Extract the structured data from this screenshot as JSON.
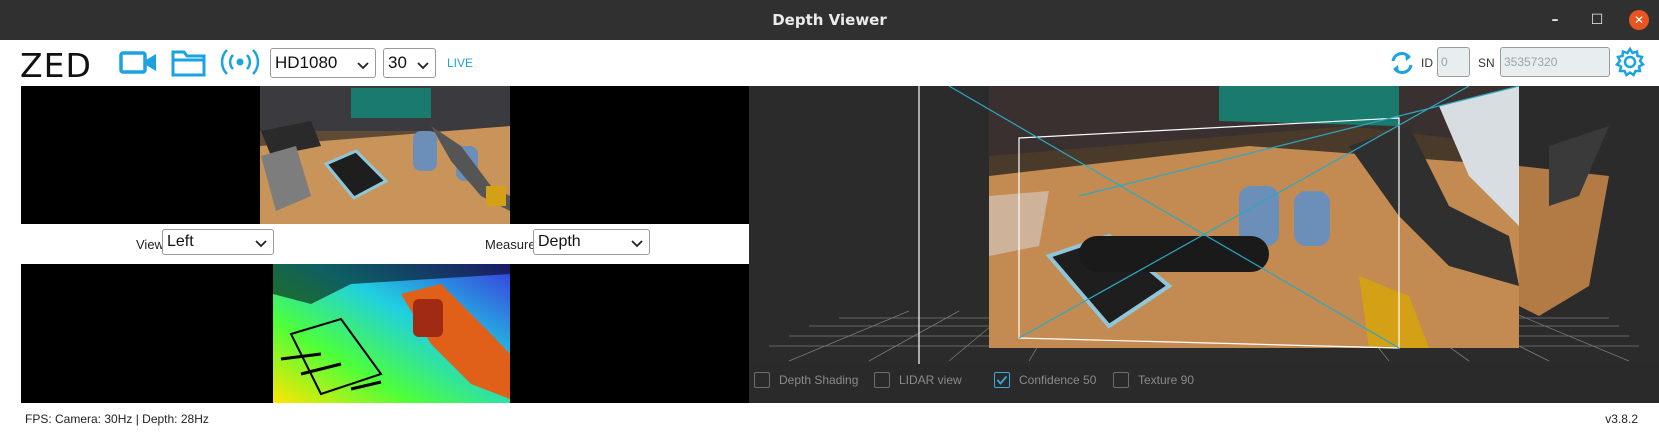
{
  "window": {
    "title": "Depth Viewer",
    "minimize": "–",
    "maximize": "☐",
    "close": "✕"
  },
  "toolbar": {
    "logo": "ZED",
    "icons": {
      "camera": "video-camera-icon",
      "folder": "folder-icon",
      "stream": "wireless-stream-icon",
      "refresh": "refresh-icon",
      "settings": "gear-icon"
    },
    "resolution": "HD1080",
    "fps": "30",
    "live_label": "LIVE",
    "id_label": "ID",
    "id_value": "0",
    "sn_label": "SN",
    "sn_value": "35357320"
  },
  "left_panel": {
    "view_label": "View",
    "view_value": "Left",
    "measure_label": "Measure",
    "measure_value": "Depth"
  },
  "viewer3d": {
    "options": [
      {
        "label": "Depth Shading",
        "checked": false
      },
      {
        "label": "LIDAR view",
        "checked": false
      },
      {
        "label": "Confidence 50",
        "checked": true
      },
      {
        "label": "Texture 90",
        "checked": false
      }
    ]
  },
  "status": {
    "fps_text": "FPS: Camera: 30Hz | Depth: 28Hz",
    "version": "v3.8.2"
  },
  "colors": {
    "accent": "#1aa3e0",
    "titlebar": "#303030",
    "close": "#e95420"
  }
}
